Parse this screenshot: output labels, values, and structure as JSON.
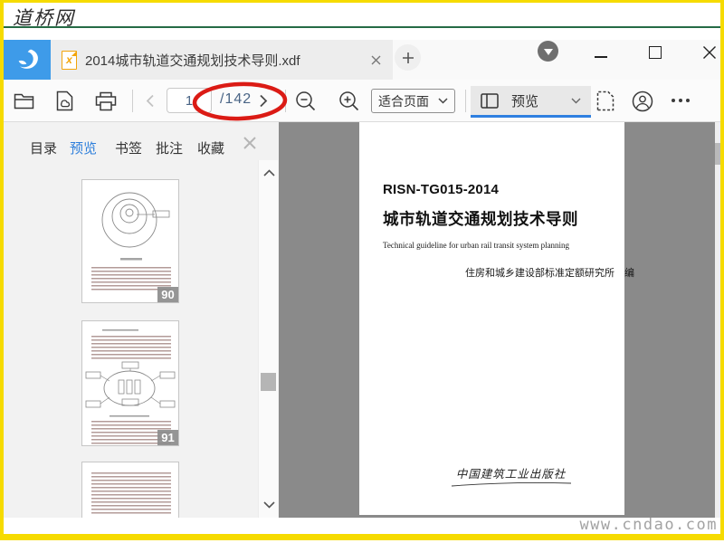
{
  "site_header": {
    "logo_text": "道桥网"
  },
  "window": {
    "tab_title": "2014城市轨道交通规划技术导则.xdf",
    "file_icon_letter": "x"
  },
  "toolbar": {
    "page_input_value": "1",
    "page_total_label": "/142",
    "fit_dropdown_value": "适合页面",
    "view_dropdown_label": "预览"
  },
  "sidebar": {
    "tabs": [
      {
        "label": "目录",
        "active": false
      },
      {
        "label": "预览",
        "active": true
      },
      {
        "label": "书签",
        "active": false
      },
      {
        "label": "批注",
        "active": false
      },
      {
        "label": "收藏",
        "active": false
      }
    ],
    "thumbnails": [
      {
        "page_badge": "90"
      },
      {
        "page_badge": "91"
      },
      {
        "page_badge": ""
      }
    ]
  },
  "document_page": {
    "standard_code": "RISN-TG015-2014",
    "title": "城市轨道交通规划技术导则",
    "subtitle_en": "Technical guideline for urban rail transit system planning",
    "author_line": "住房和城乡建设部标准定额研究所　编",
    "publisher": "中国建筑工业出版社"
  },
  "watermark": {
    "bottom_right": "www.cndao.com"
  },
  "colors": {
    "frame_yellow": "#F6DB00",
    "logo_blue": "#3E9BE9",
    "accent_blue": "#2E7FDB",
    "annotation_red": "#DB1B15",
    "header_green": "#256B45",
    "viewer_gray": "#8A8A8A"
  }
}
